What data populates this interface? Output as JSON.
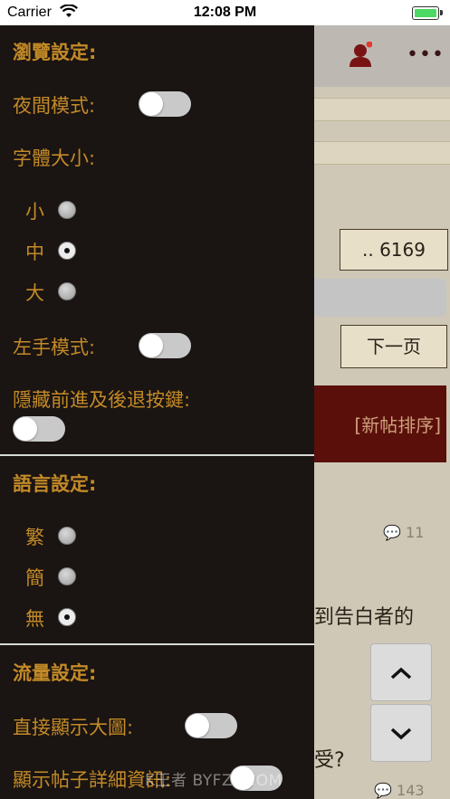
{
  "status_bar": {
    "carrier": "Carrier",
    "time": "12:08 PM"
  },
  "background": {
    "page_box": ".. 6169",
    "next_page": "下一页",
    "sort_banner": "[新帖排序]",
    "comment_count_1": "11",
    "snippet_1": "到告白者的",
    "snippet_2": "受?",
    "comment_count_2": "143",
    "up_arrow": "︿",
    "down_arrow": "﹀"
  },
  "drawer": {
    "browse_settings": {
      "title": "瀏覽設定:",
      "night_mode_label": "夜間模式:",
      "night_mode_on": false,
      "font_size_label": "字體大小:",
      "font_size_options": [
        "小",
        "中",
        "大"
      ],
      "font_size_selected": "中",
      "left_hand_label": "左手模式:",
      "left_hand_on": false,
      "hide_nav_label": "隱藏前進及後退按鍵:",
      "hide_nav_on": false
    },
    "language_settings": {
      "title": "語言設定:",
      "options": [
        "繁",
        "簡",
        "無"
      ],
      "selected": "無"
    },
    "traffic_settings": {
      "title": "流量設定:",
      "show_large_image_label": "直接顯示大圖:",
      "show_large_image_on": false,
      "show_details_label": "顯示帖子詳細資訊:",
      "show_details_on": false
    }
  },
  "watermark": "K王者  BYFZY.COM",
  "colors": {
    "drawer_bg": "#1a1412",
    "accent_text": "#c38a27",
    "toggle_off": "#c9c9c9",
    "banner_bg": "#5a0f0b"
  }
}
